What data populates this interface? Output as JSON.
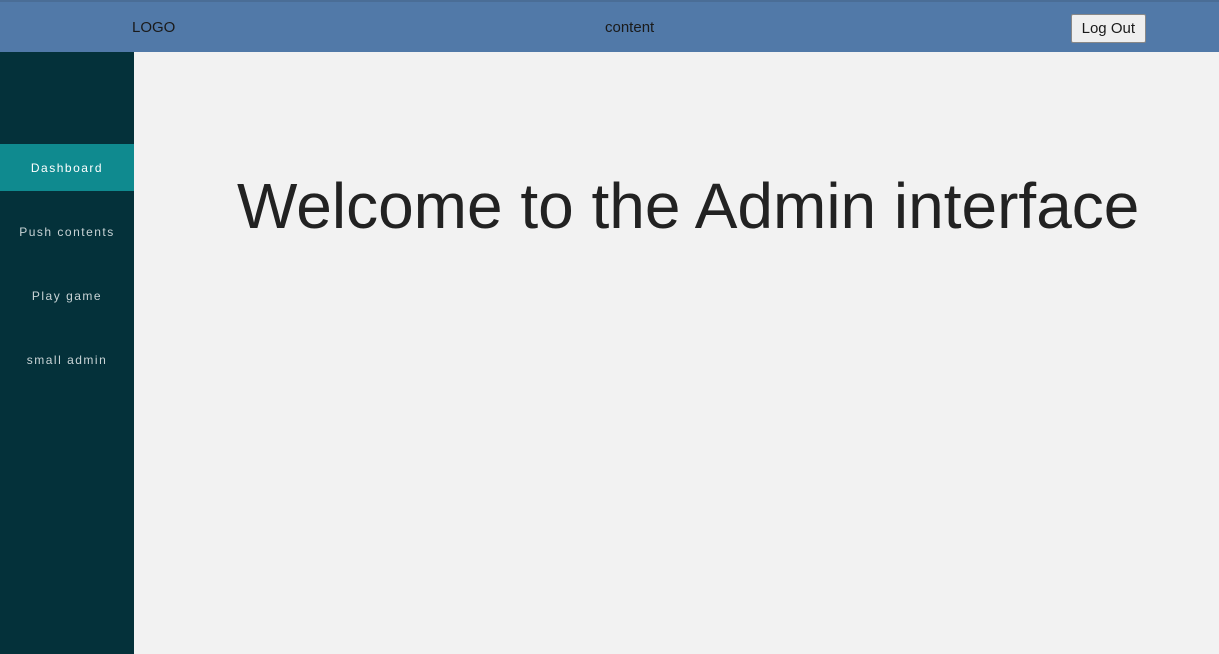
{
  "header": {
    "logo": "LOGO",
    "content_label": "content",
    "logout": "Log Out"
  },
  "sidebar": {
    "items": [
      {
        "label": "Dashboard",
        "active": true
      },
      {
        "label": "Push contents",
        "active": false
      },
      {
        "label": "Play game",
        "active": false
      },
      {
        "label": "small admin",
        "active": false
      }
    ]
  },
  "main": {
    "heading": "Welcome to the Admin interface"
  }
}
